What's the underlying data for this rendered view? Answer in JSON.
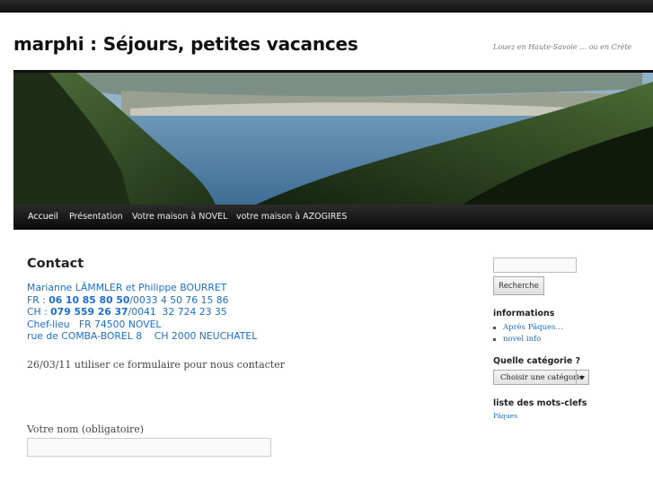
{
  "header": {
    "site_title": "marphi : Séjours, petites vacances",
    "site_description": "Louez en Haute-Savoie … ou en Crète"
  },
  "nav": {
    "items": [
      {
        "label": "Accueil",
        "active": true
      },
      {
        "label": "Présentation"
      },
      {
        "label": "Votre maison à NOVEL"
      },
      {
        "label": "votre maison à AZOGIRES"
      }
    ]
  },
  "main": {
    "title": "Contact",
    "contact": {
      "names": "Marianne LÄMMLER et Philippe BOURRET",
      "fr_prefix": "FR : ",
      "fr_phone": "06 10 85 80 50",
      "fr_rest": "/0033 4 50 76 15 86",
      "ch_prefix": "CH : ",
      "ch_phone": "079 559 26 37",
      "ch_rest": "/0041  32 724 23 35",
      "line4": "Chef-lieu   FR 74500 NOVEL",
      "line5": "rue de COMBA-BOREL 8    CH 2000 NEUCHATEL"
    },
    "note": "26/03/11 utiliser ce formulaire pour nous contacter",
    "form": {
      "name_label": "Votre nom (obligatoire)",
      "name_value": ""
    }
  },
  "sidebar": {
    "search": {
      "value": "",
      "button_label": "Recherche"
    },
    "informations": {
      "title": "informations",
      "items": [
        "Après Pâques…",
        "novel info"
      ]
    },
    "categories": {
      "title": "Quelle catégorie ?",
      "selected": "Choisir une catégorie"
    },
    "tags": {
      "title": "liste des mots-clefs",
      "items": [
        "Pâques"
      ]
    }
  },
  "colors": {
    "link": "#1b6fd3",
    "nav_bg": "#111111",
    "title": "#111111"
  }
}
